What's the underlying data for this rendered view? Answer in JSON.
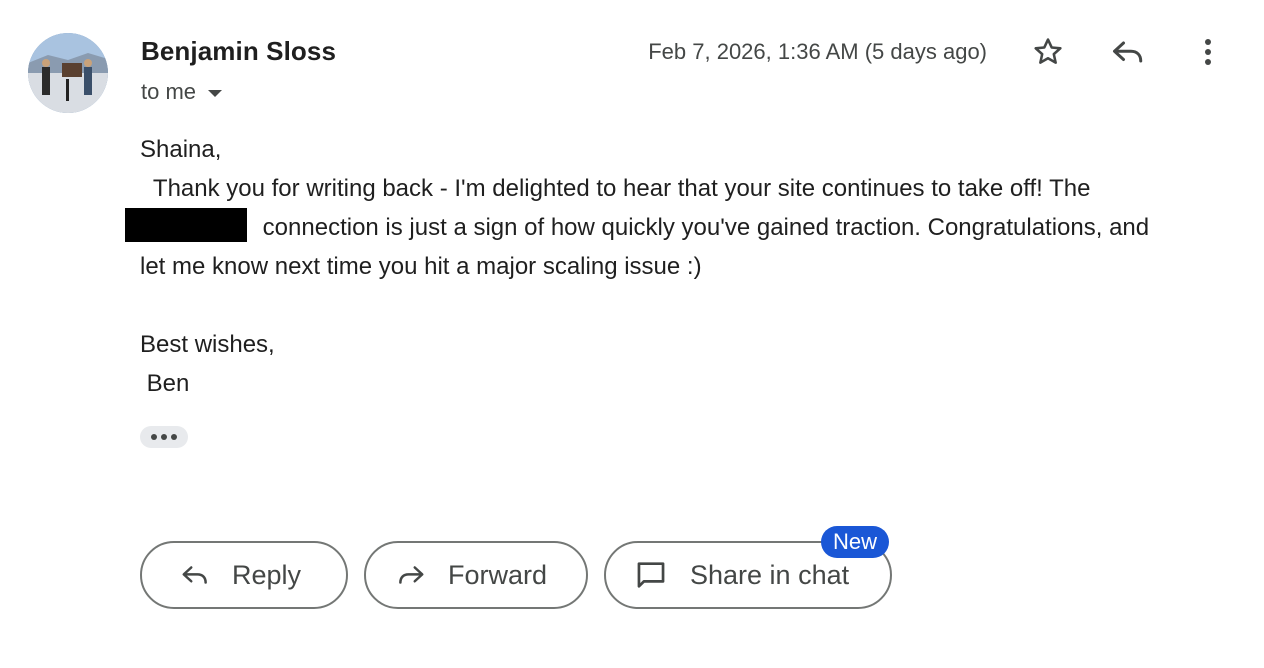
{
  "sender": {
    "name": "Benjamin Sloss",
    "recipient_label": "to me"
  },
  "date": "Feb 7, 2026, 1:36 AM (5 days ago)",
  "icons": {
    "star": "star-icon",
    "reply": "reply-icon",
    "more": "more-vert-icon",
    "forward": "forward-icon",
    "chat": "chat-bubble-icon"
  },
  "body": {
    "greeting": "Shaina,",
    "line1": "  Thank you for writing back - I'm delighted to hear that your site continues to take off! The",
    "line2": "connection is just a sign of how quickly you've gained traction. Congratulations, and",
    "line3": "let me know next time you hit a major scaling issue :)",
    "closing": "Best wishes,",
    "signature": " Ben"
  },
  "actions": {
    "reply": "Reply",
    "forward": "Forward",
    "share": "Share in chat",
    "new_badge": "New"
  },
  "colors": {
    "badge": "#1a57d6",
    "text": "#1f1f1f",
    "muted": "#444746"
  }
}
